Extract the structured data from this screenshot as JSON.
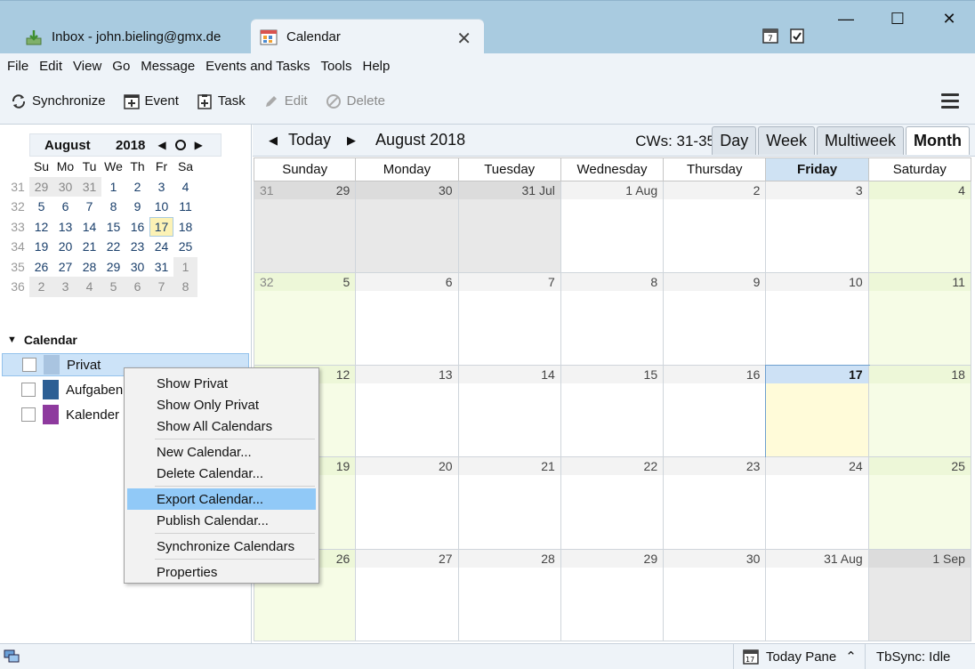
{
  "tabs": [
    {
      "label": "Inbox - john.bieling@gmx.de",
      "icon": "inbox-download-icon"
    },
    {
      "label": "Calendar",
      "icon": "calendar-tab-icon"
    }
  ],
  "window_controls": {
    "minimize": "—",
    "maximize": "☐",
    "close": "✕"
  },
  "menubar": [
    "File",
    "Edit",
    "View",
    "Go",
    "Message",
    "Events and Tasks",
    "Tools",
    "Help"
  ],
  "toolbar": {
    "synchronize": "Synchronize",
    "event": "Event",
    "task": "Task",
    "edit": "Edit",
    "delete": "Delete"
  },
  "minical": {
    "month": "August",
    "year": "2018",
    "weekday_headers": [
      "Su",
      "Mo",
      "Tu",
      "We",
      "Th",
      "Fr",
      "Sa"
    ],
    "weeks": [
      {
        "wk": "31",
        "days": [
          "29",
          "30",
          "31",
          "1",
          "2",
          "3",
          "4"
        ]
      },
      {
        "wk": "32",
        "days": [
          "5",
          "6",
          "7",
          "8",
          "9",
          "10",
          "11"
        ]
      },
      {
        "wk": "33",
        "days": [
          "12",
          "13",
          "14",
          "15",
          "16",
          "17",
          "18"
        ]
      },
      {
        "wk": "34",
        "days": [
          "19",
          "20",
          "21",
          "22",
          "23",
          "24",
          "25"
        ]
      },
      {
        "wk": "35",
        "days": [
          "26",
          "27",
          "28",
          "29",
          "30",
          "31",
          "1"
        ]
      },
      {
        "wk": "36",
        "days": [
          "2",
          "3",
          "4",
          "5",
          "6",
          "7",
          "8"
        ]
      }
    ]
  },
  "calendar_list": {
    "heading": "Calendar",
    "items": [
      {
        "name": "Privat",
        "color": "#a9c4e0",
        "selected": true
      },
      {
        "name": "Aufgaben",
        "color": "#2d5f94",
        "selected": false
      },
      {
        "name": "Kalender (",
        "color": "#8e3a9e",
        "selected": false
      }
    ]
  },
  "navbar": {
    "prev": "◀",
    "today": "Today",
    "next": "▶",
    "range": "August 2018",
    "cws": "CWs: 31-35"
  },
  "views": [
    "Day",
    "Week",
    "Multiweek",
    "Month"
  ],
  "active_view": "Month",
  "month": {
    "weekdays": [
      "Sunday",
      "Monday",
      "Tuesday",
      "Wednesday",
      "Thursday",
      "Friday",
      "Saturday"
    ],
    "today_column": "Friday",
    "weeks": [
      {
        "wk": "31",
        "days": [
          "29",
          "30",
          "31 Jul",
          "1 Aug",
          "2",
          "3",
          "4"
        ]
      },
      {
        "wk": "32",
        "days": [
          "5",
          "6",
          "7",
          "8",
          "9",
          "10",
          "11"
        ]
      },
      {
        "wk": "",
        "days": [
          "12",
          "13",
          "14",
          "15",
          "16",
          "17",
          "18"
        ]
      },
      {
        "wk": "",
        "days": [
          "19",
          "20",
          "21",
          "22",
          "23",
          "24",
          "25"
        ]
      },
      {
        "wk": "",
        "days": [
          "26",
          "27",
          "28",
          "29",
          "30",
          "31 Aug",
          "1 Sep"
        ]
      }
    ]
  },
  "context_menu": [
    {
      "label": "Show Privat"
    },
    {
      "label": "Show Only Privat"
    },
    {
      "label": "Show All Calendars"
    },
    {
      "sep": true
    },
    {
      "label": "New Calendar..."
    },
    {
      "label": "Delete Calendar..."
    },
    {
      "sep": true
    },
    {
      "label": "Export Calendar...",
      "highlight": true
    },
    {
      "label": "Publish Calendar..."
    },
    {
      "sep": true
    },
    {
      "label": "Synchronize Calendars"
    },
    {
      "sep": true
    },
    {
      "label": "Properties"
    }
  ],
  "statusbar": {
    "today_pane": "Today Pane",
    "tbsync": "TbSync: Idle"
  },
  "colors": {
    "accent": "#a9cbe0",
    "today_bg": "#fffbd9",
    "weekend_bg": "#f6fce6",
    "menu_highlight": "#91c9f7"
  }
}
